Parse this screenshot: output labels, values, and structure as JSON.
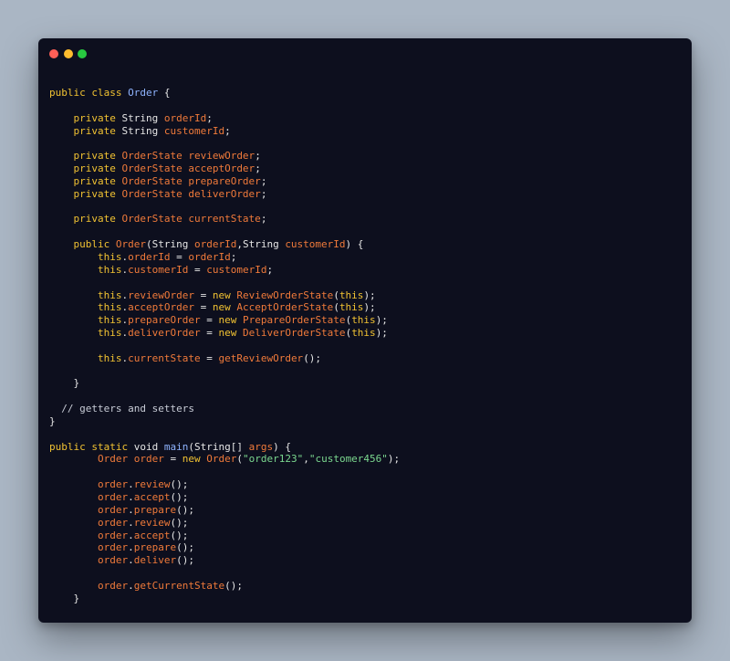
{
  "window": {
    "dots": [
      "close",
      "minimize",
      "maximize"
    ],
    "colors": {
      "close": "#ff5f57",
      "minimize": "#febc2e",
      "maximize": "#28c840"
    }
  },
  "code_lines": [
    [
      [
        "keyword",
        "public class "
      ],
      [
        "class",
        "Order"
      ],
      [
        "plain",
        " {"
      ]
    ],
    [],
    [
      [
        "plain",
        "    "
      ],
      [
        "keyword",
        "private "
      ],
      [
        "type",
        "String "
      ],
      [
        "field",
        "orderId"
      ],
      [
        "plain",
        ";"
      ]
    ],
    [
      [
        "plain",
        "    "
      ],
      [
        "keyword",
        "private "
      ],
      [
        "type",
        "String "
      ],
      [
        "field",
        "customerId"
      ],
      [
        "plain",
        ";"
      ]
    ],
    [],
    [
      [
        "plain",
        "    "
      ],
      [
        "keyword",
        "private "
      ],
      [
        "field",
        "OrderState reviewOrder"
      ],
      [
        "plain",
        ";"
      ]
    ],
    [
      [
        "plain",
        "    "
      ],
      [
        "keyword",
        "private "
      ],
      [
        "field",
        "OrderState acceptOrder"
      ],
      [
        "plain",
        ";"
      ]
    ],
    [
      [
        "plain",
        "    "
      ],
      [
        "keyword",
        "private "
      ],
      [
        "field",
        "OrderState prepareOrder"
      ],
      [
        "plain",
        ";"
      ]
    ],
    [
      [
        "plain",
        "    "
      ],
      [
        "keyword",
        "private "
      ],
      [
        "field",
        "OrderState deliverOrder"
      ],
      [
        "plain",
        ";"
      ]
    ],
    [],
    [
      [
        "plain",
        "    "
      ],
      [
        "keyword",
        "private "
      ],
      [
        "field",
        "OrderState currentState"
      ],
      [
        "plain",
        ";"
      ]
    ],
    [],
    [
      [
        "plain",
        "    "
      ],
      [
        "keyword",
        "public "
      ],
      [
        "method",
        "Order"
      ],
      [
        "plain",
        "(String "
      ],
      [
        "field",
        "orderId"
      ],
      [
        "plain",
        ",String "
      ],
      [
        "field",
        "customerId"
      ],
      [
        "plain",
        ") {"
      ]
    ],
    [
      [
        "plain",
        "        "
      ],
      [
        "keyword",
        "this"
      ],
      [
        "plain",
        "."
      ],
      [
        "field",
        "orderId"
      ],
      [
        "plain",
        " = "
      ],
      [
        "field",
        "orderId"
      ],
      [
        "plain",
        ";"
      ]
    ],
    [
      [
        "plain",
        "        "
      ],
      [
        "keyword",
        "this"
      ],
      [
        "plain",
        "."
      ],
      [
        "field",
        "customerId"
      ],
      [
        "plain",
        " = "
      ],
      [
        "field",
        "customerId"
      ],
      [
        "plain",
        ";"
      ]
    ],
    [],
    [
      [
        "plain",
        "        "
      ],
      [
        "keyword",
        "this"
      ],
      [
        "plain",
        "."
      ],
      [
        "field",
        "reviewOrder"
      ],
      [
        "plain",
        " = "
      ],
      [
        "keyword",
        "new "
      ],
      [
        "method",
        "ReviewOrderState"
      ],
      [
        "plain",
        "("
      ],
      [
        "keyword",
        "this"
      ],
      [
        "plain",
        ");"
      ]
    ],
    [
      [
        "plain",
        "        "
      ],
      [
        "keyword",
        "this"
      ],
      [
        "plain",
        "."
      ],
      [
        "field",
        "acceptOrder"
      ],
      [
        "plain",
        " = "
      ],
      [
        "keyword",
        "new "
      ],
      [
        "method",
        "AcceptOrderState"
      ],
      [
        "plain",
        "("
      ],
      [
        "keyword",
        "this"
      ],
      [
        "plain",
        ");"
      ]
    ],
    [
      [
        "plain",
        "        "
      ],
      [
        "keyword",
        "this"
      ],
      [
        "plain",
        "."
      ],
      [
        "field",
        "prepareOrder"
      ],
      [
        "plain",
        " = "
      ],
      [
        "keyword",
        "new "
      ],
      [
        "method",
        "PrepareOrderState"
      ],
      [
        "plain",
        "("
      ],
      [
        "keyword",
        "this"
      ],
      [
        "plain",
        ");"
      ]
    ],
    [
      [
        "plain",
        "        "
      ],
      [
        "keyword",
        "this"
      ],
      [
        "plain",
        "."
      ],
      [
        "field",
        "deliverOrder"
      ],
      [
        "plain",
        " = "
      ],
      [
        "keyword",
        "new "
      ],
      [
        "method",
        "DeliverOrderState"
      ],
      [
        "plain",
        "("
      ],
      [
        "keyword",
        "this"
      ],
      [
        "plain",
        ");"
      ]
    ],
    [],
    [
      [
        "plain",
        "        "
      ],
      [
        "keyword",
        "this"
      ],
      [
        "plain",
        "."
      ],
      [
        "field",
        "currentState"
      ],
      [
        "plain",
        " = "
      ],
      [
        "method",
        "getReviewOrder"
      ],
      [
        "plain",
        "();"
      ]
    ],
    [],
    [
      [
        "plain",
        "    }"
      ]
    ],
    [],
    [
      [
        "comment",
        "  // getters and setters"
      ]
    ],
    [
      [
        "plain",
        "}"
      ]
    ],
    [],
    [
      [
        "keyword",
        "public static "
      ],
      [
        "type",
        "void "
      ],
      [
        "class",
        "main"
      ],
      [
        "plain",
        "(String[] "
      ],
      [
        "field",
        "args"
      ],
      [
        "plain",
        ") {"
      ]
    ],
    [
      [
        "plain",
        "        "
      ],
      [
        "field",
        "Order order"
      ],
      [
        "plain",
        " = "
      ],
      [
        "keyword",
        "new "
      ],
      [
        "method",
        "Order"
      ],
      [
        "plain",
        "("
      ],
      [
        "string",
        "\"order123\""
      ],
      [
        "plain",
        ","
      ],
      [
        "string",
        "\"customer456\""
      ],
      [
        "plain",
        ");"
      ]
    ],
    [],
    [
      [
        "plain",
        "        "
      ],
      [
        "field",
        "order"
      ],
      [
        "plain",
        "."
      ],
      [
        "method",
        "review"
      ],
      [
        "plain",
        "();"
      ]
    ],
    [
      [
        "plain",
        "        "
      ],
      [
        "field",
        "order"
      ],
      [
        "plain",
        "."
      ],
      [
        "method",
        "accept"
      ],
      [
        "plain",
        "();"
      ]
    ],
    [
      [
        "plain",
        "        "
      ],
      [
        "field",
        "order"
      ],
      [
        "plain",
        "."
      ],
      [
        "method",
        "prepare"
      ],
      [
        "plain",
        "();"
      ]
    ],
    [
      [
        "plain",
        "        "
      ],
      [
        "field",
        "order"
      ],
      [
        "plain",
        "."
      ],
      [
        "method",
        "review"
      ],
      [
        "plain",
        "();"
      ]
    ],
    [
      [
        "plain",
        "        "
      ],
      [
        "field",
        "order"
      ],
      [
        "plain",
        "."
      ],
      [
        "method",
        "accept"
      ],
      [
        "plain",
        "();"
      ]
    ],
    [
      [
        "plain",
        "        "
      ],
      [
        "field",
        "order"
      ],
      [
        "plain",
        "."
      ],
      [
        "method",
        "prepare"
      ],
      [
        "plain",
        "();"
      ]
    ],
    [
      [
        "plain",
        "        "
      ],
      [
        "field",
        "order"
      ],
      [
        "plain",
        "."
      ],
      [
        "method",
        "deliver"
      ],
      [
        "plain",
        "();"
      ]
    ],
    [],
    [
      [
        "plain",
        "        "
      ],
      [
        "field",
        "order"
      ],
      [
        "plain",
        "."
      ],
      [
        "method",
        "getCurrentState"
      ],
      [
        "plain",
        "();"
      ]
    ],
    [
      [
        "plain",
        "    }"
      ]
    ]
  ]
}
